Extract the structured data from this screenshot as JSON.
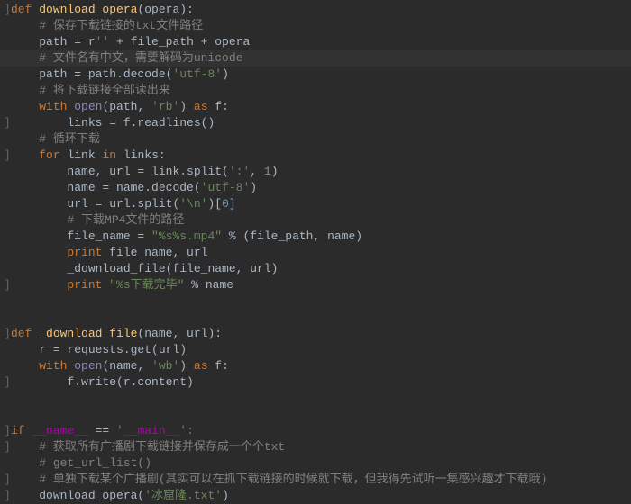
{
  "code": {
    "def1": {
      "def": "def ",
      "name": "download_opera",
      "sig": "(opera):"
    },
    "c1": "# 保存下载链接的txt文件路径",
    "l_path1": {
      "a": "path = r",
      "s": "''",
      "b": " + file_path + opera"
    },
    "c2": "# 文件名有中文，需要解码为unicode",
    "l_path2": {
      "a": "path = path.decode(",
      "s": "'utf-8'",
      "b": ")"
    },
    "c3": "# 将下载链接全部读出来",
    "l_with1": {
      "w": "with ",
      "o": "open",
      "a": "(path, ",
      "s": "'rb'",
      "b": ") ",
      "as": "as ",
      "f": "f:"
    },
    "l_links": "links = f.readlines()",
    "c4": "# 循环下载",
    "l_for": {
      "for": "for ",
      "a": "link ",
      "in": "in ",
      "b": "links:"
    },
    "l_split": {
      "a": "name, url = link.split(",
      "s": "':'",
      "b": ", ",
      "n": "1",
      "c": ")"
    },
    "l_decode": {
      "a": "name = name.decode(",
      "s": "'utf-8'",
      "b": ")"
    },
    "l_urlsplit": {
      "a": "url = url.split(",
      "s": "'\\n'",
      "b": ")[",
      "n": "0",
      "c": "]"
    },
    "c5": "# 下载MP4文件的路径",
    "l_fname": {
      "a": "file_name = ",
      "s": "\"%s%s.mp4\"",
      "b": " % (file_path, name)"
    },
    "l_print1": {
      "p": "print ",
      "a": "file_name, url"
    },
    "l_dlcall": "_download_file(file_name, url)",
    "l_print2": {
      "p": "print ",
      "s": "\"%s下载完毕\"",
      "b": " % name"
    },
    "def2": {
      "def": "def ",
      "name": "_download_file",
      "sig": "(name, url):"
    },
    "l_req": "r = requests.get(url)",
    "l_with2": {
      "w": "with ",
      "o": "open",
      "a": "(name, ",
      "s": "'wb'",
      "b": ") ",
      "as": "as ",
      "f": "f:"
    },
    "l_write": "f.write(r.content)",
    "l_main": {
      "if": "if ",
      "n1": "__name__",
      "eq": " == ",
      "s": "'",
      "n2": "__main__",
      "s2": "':"
    },
    "c6": "# 获取所有广播剧下载链接并保存成一个个txt",
    "c7": "# get_url_list()",
    "c8": "# 单独下载某个广播剧(其实可以在抓下载链接的时候就下载，但我得先试听一集感兴趣才下载哦)",
    "l_call": {
      "a": "download_opera(",
      "s": "'冰窟隆.txt'",
      "b": ")"
    }
  }
}
